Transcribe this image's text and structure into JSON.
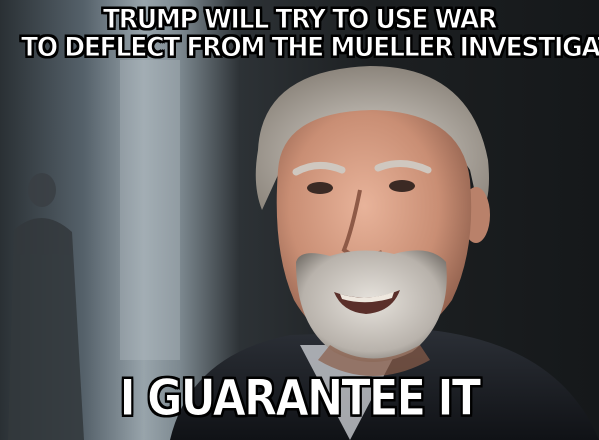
{
  "meme": {
    "top_text": {
      "line_1": "TRUMP WILL TRY TO USE WAR",
      "line_2": "TO DEFLECT FROM THE MUELLER INVESTIGATION"
    },
    "bottom_text": "I GUARANTEE IT"
  }
}
